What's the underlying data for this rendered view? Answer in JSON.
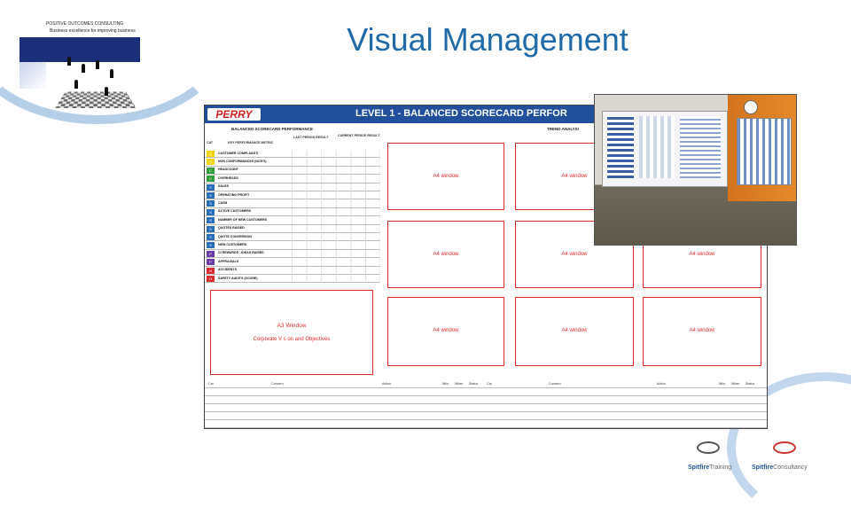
{
  "slide": {
    "title": "Visual Management"
  },
  "corner_logo": {
    "line1": "POSITIVE OUTCOMES CONSULTING",
    "line2": "Business excellence for improving business"
  },
  "board": {
    "brand": "PERRY",
    "heading": "LEVEL 1 - BALANCED SCORECARD PERFOR",
    "left_section": "BALANCED SCORECARD PERFORMANCE",
    "right_section": "TREND ANALYSI",
    "col_cat": "CAT",
    "col_metric": "KEY PERFORMANCE METRIC",
    "col_last_period": "LAST PERIOD RESULT",
    "col_current": "CURRENT PERIOD RESULT",
    "kpis": [
      {
        "cat": "Q",
        "name": "CUSTOMER COMPLAINTS",
        "color": "#f2d500"
      },
      {
        "cat": "Q",
        "name": "NON CONFORMANCES (NCR'S)",
        "color": "#f2d500"
      },
      {
        "cat": "C",
        "name": "HEADCOUNT",
        "color": "#2e9e3a"
      },
      {
        "cat": "C",
        "name": "OVERHEADS",
        "color": "#2e9e3a"
      },
      {
        "cat": "S",
        "name": "SALES",
        "color": "#2a6ebb"
      },
      {
        "cat": "S",
        "name": "OPERATING PROFIT",
        "color": "#2a6ebb"
      },
      {
        "cat": "S",
        "name": "CASH",
        "color": "#2a6ebb"
      },
      {
        "cat": "S",
        "name": "ACTIVE CUSTOMERS",
        "color": "#2a6ebb"
      },
      {
        "cat": "S",
        "name": "NUMBER OF NEW CUSTOMERS",
        "color": "#2a6ebb"
      },
      {
        "cat": "S",
        "name": "QUOTES RAISED",
        "color": "#2a6ebb"
      },
      {
        "cat": "S",
        "name": "QUOTE CONVERSION",
        "color": "#2a6ebb"
      },
      {
        "cat": "S",
        "name": "NEW CUSTOMERS",
        "color": "#2a6ebb"
      },
      {
        "cat": "P",
        "name": "CI REWARDS - IDEAS RAISED",
        "color": "#6a3aa8"
      },
      {
        "cat": "P",
        "name": "APPRAISALS",
        "color": "#6a3aa8"
      },
      {
        "cat": "H",
        "name": "ACCIDENTS",
        "color": "#d92b2b"
      },
      {
        "cat": "H",
        "name": "SAFETY AUDITS (SCORE)",
        "color": "#d92b2b"
      }
    ],
    "a3_window": {
      "label": "A3 Window",
      "caption": "Corporate V s on and Objectives"
    },
    "a4_windows": [
      "A4 window",
      "A4 window",
      "A4 window",
      "A4 window",
      "A4 window",
      "A4 window",
      "A4 window",
      "A4 window"
    ],
    "action_headers_left": [
      "Cat",
      "Concern",
      "Action",
      "Who",
      "When",
      "Status"
    ],
    "action_headers_right": [
      "Cat",
      "Concern",
      "Action",
      "Who",
      "When",
      "Status"
    ]
  },
  "footer": {
    "brand1": "Spitfire",
    "brand1_suffix": "Training",
    "brand2": "Spitfire",
    "brand2_suffix": "Consultancy"
  }
}
